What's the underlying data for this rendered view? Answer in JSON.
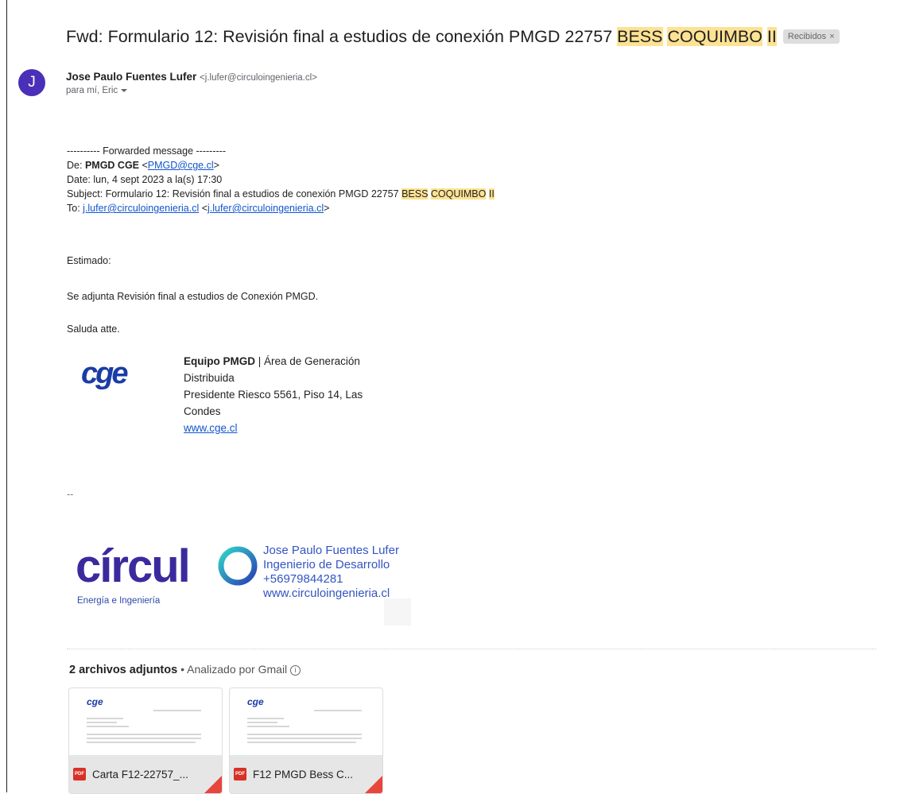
{
  "email": {
    "subject_prefix": "Fwd: Formulario 12: Revisión final a estudios de conexión PMGD 22757 ",
    "subject_hl1": "BESS",
    "subject_hl2": "COQUIMBO",
    "subject_hl3": "II",
    "label": "Recibidos",
    "label_close": "×",
    "avatar_letter": "J",
    "sender_name": "Jose Paulo Fuentes Lufer",
    "sender_email": "<j.lufer@circuloingenieria.cl>",
    "to_line": "para mí, Eric"
  },
  "forwarded": {
    "separator": "---------- Forwarded message ---------",
    "from_label": "De: ",
    "from_name": "PMGD CGE",
    "from_open": " <",
    "from_email": "PMGD@cge.cl",
    "from_close": ">",
    "date": "Date: lun, 4 sept 2023 a la(s) 17:30",
    "subject_prefix": "Subject: Formulario 12: Revisión final a estudios de conexión PMGD 22757 ",
    "subject_hl1": "BESS",
    "subject_hl2": "COQUIMBO",
    "subject_hl3": "II",
    "to_label": "To: ",
    "to_email1": "j.lufer@circuloingenieria.cl",
    "to_open": " <",
    "to_email2": "j.lufer@circuloingenieria.cl",
    "to_close": ">"
  },
  "message": {
    "greeting": "Estimado:",
    "body": "Se adjunta Revisión final a estudios de Conexión PMGD.",
    "closing": "Saluda atte."
  },
  "cge_signature": {
    "logo_text": "cge",
    "team": "Equipo PMGD",
    "area": " | Área de Generación",
    "area2": "Distribuida",
    "address1": "Presidente Riesco 5561, Piso 14, Las",
    "address2": "Condes",
    "website": "www.cge.cl"
  },
  "personal_signature": {
    "dashes": "--",
    "logo_text": "círculo",
    "logo_sub": "Energía e Ingeniería",
    "name": "Jose Paulo Fuentes Lufer",
    "role": "Ingenierio de Desarrollo",
    "phone": "+56979844281",
    "website": "www.circuloingenieria.cl"
  },
  "attachments": {
    "count_label": "2 archivos adjuntos",
    "sep": " • ",
    "scan_label": "Analizado por Gmail",
    "info_glyph": "i",
    "items": [
      {
        "name": "Carta F12-22757_...",
        "type": "PDF",
        "thumb_logo": "cge"
      },
      {
        "name": "F12 PMGD Bess C...",
        "type": "PDF",
        "thumb_logo": "cge"
      }
    ]
  },
  "colors": {
    "highlight": "#fde293",
    "link": "#1155cc",
    "avatar": "#4a2fb8",
    "cge_blue": "#1a3ca5",
    "circulo_blue": "#3455c2",
    "pdf_red": "#d93025"
  }
}
